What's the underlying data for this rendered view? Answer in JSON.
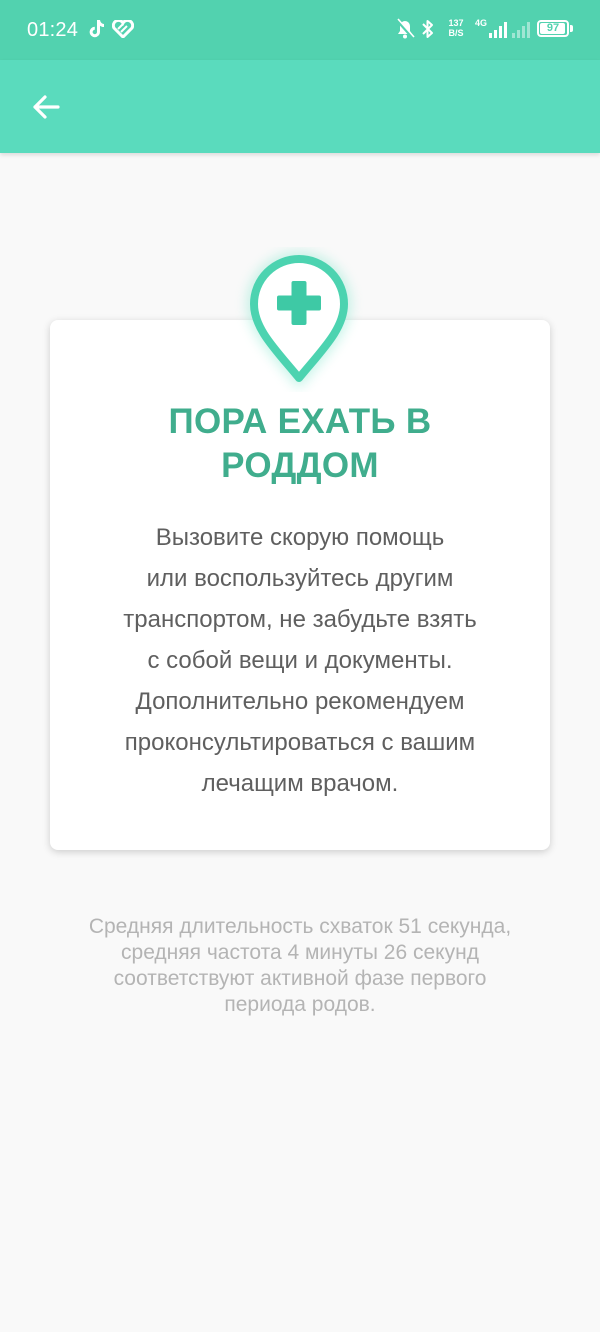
{
  "status_bar": {
    "time": "01:24",
    "net_speed_value": "137",
    "net_speed_unit": "B/S",
    "network_type": "4G",
    "battery_level": "97",
    "icons": [
      "tiktok-icon",
      "heart-app-icon",
      "bell-muted-icon",
      "bluetooth-icon",
      "signal-icon",
      "battery-icon"
    ]
  },
  "toolbar": {
    "back_icon": "arrow-left-icon"
  },
  "card": {
    "icon": "medical-location-pin-icon",
    "title_lines": [
      "ПОРА ЕХАТЬ В",
      "РОДДОМ"
    ],
    "message_lines": [
      "Вызовите скорую помощь",
      "или воспользуйтесь другим",
      "транспортом, не забудьте взять",
      "с собой вещи и документы.",
      "Дополнительно рекомендуем",
      "проконсультироваться с вашим",
      "лечащим врачом."
    ]
  },
  "info": {
    "lines": [
      "Средняя длительность схваток 51 секунда,",
      "средняя частота 4 минуты 26 секунд",
      "соответствуют активной фазе первого",
      "периода родов."
    ]
  },
  "colors": {
    "status_bar": "#52d2af",
    "toolbar": "#5adbbd",
    "accent": "#40ad8d",
    "background": "#f9f9f9",
    "message_text": "#5f5f5f",
    "info_text": "#b4b4b4"
  }
}
